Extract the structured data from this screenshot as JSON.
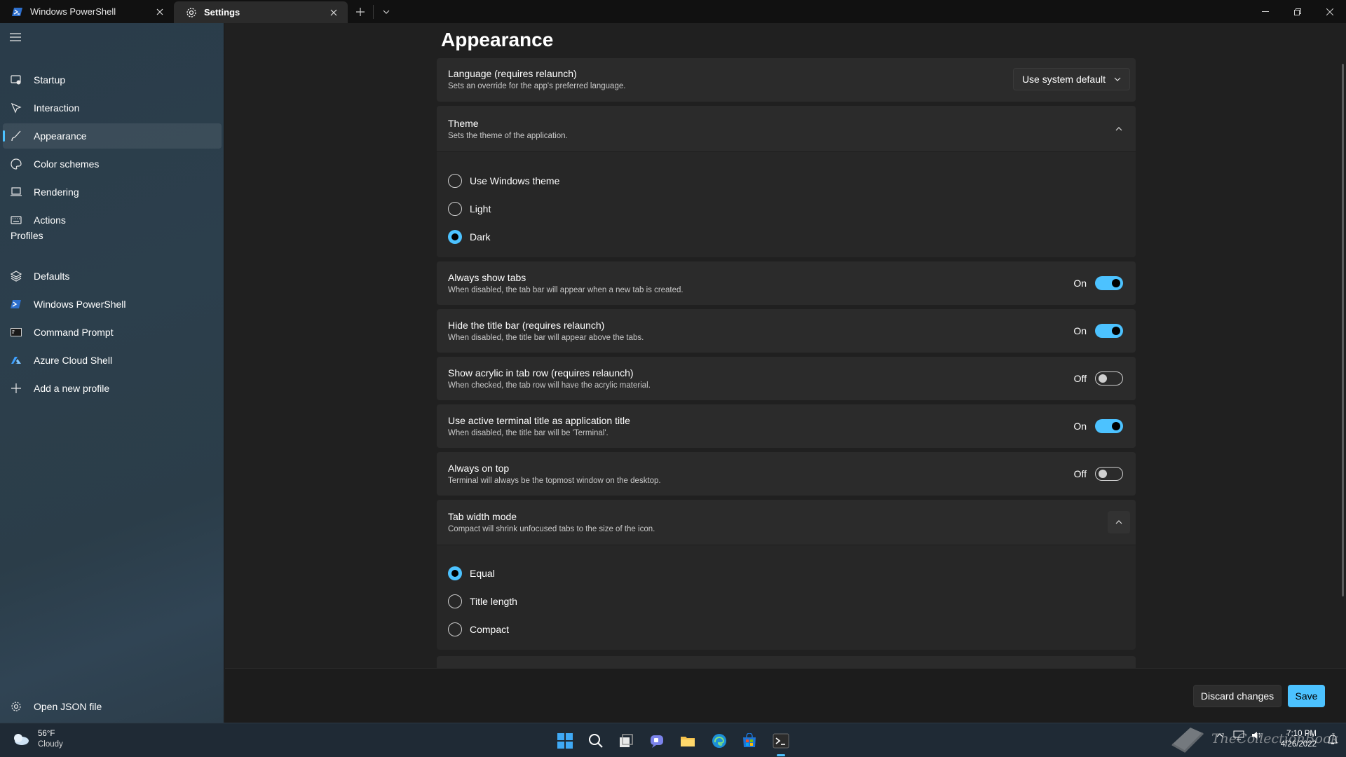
{
  "tabs": [
    {
      "title": "Windows PowerShell",
      "active": false
    },
    {
      "title": "Settings",
      "active": true
    }
  ],
  "sidebar": {
    "items": [
      {
        "label": "Startup",
        "icon": "startup-icon"
      },
      {
        "label": "Interaction",
        "icon": "interaction-icon"
      },
      {
        "label": "Appearance",
        "icon": "brush-icon",
        "selected": true
      },
      {
        "label": "Color schemes",
        "icon": "palette-icon"
      },
      {
        "label": "Rendering",
        "icon": "monitor-icon"
      },
      {
        "label": "Actions",
        "icon": "keyboard-icon"
      }
    ],
    "profiles_header": "Profiles",
    "profiles": [
      {
        "label": "Defaults",
        "icon": "layers-icon"
      },
      {
        "label": "Windows PowerShell",
        "icon": "powershell-icon"
      },
      {
        "label": "Command Prompt",
        "icon": "cmd-icon"
      },
      {
        "label": "Azure Cloud Shell",
        "icon": "azure-icon"
      },
      {
        "label": "Add a new profile",
        "icon": "plus-icon"
      }
    ],
    "open_json": "Open JSON file"
  },
  "page": {
    "title": "Appearance",
    "language": {
      "title": "Language (requires relaunch)",
      "desc": "Sets an override for the app's preferred language.",
      "value": "Use system default"
    },
    "theme": {
      "title": "Theme",
      "desc": "Sets the theme of the application.",
      "options": [
        "Use Windows theme",
        "Light",
        "Dark"
      ],
      "selected": "Dark"
    },
    "toggles": [
      {
        "title": "Always show tabs",
        "desc": "When disabled, the tab bar will appear when a new tab is created.",
        "state": "On"
      },
      {
        "title": "Hide the title bar (requires relaunch)",
        "desc": "When disabled, the title bar will appear above the tabs.",
        "state": "On"
      },
      {
        "title": "Show acrylic in tab row (requires relaunch)",
        "desc": "When checked, the tab row will have the acrylic material.",
        "state": "Off"
      },
      {
        "title": "Use active terminal title as application title",
        "desc": "When disabled, the title bar will be 'Terminal'.",
        "state": "On"
      },
      {
        "title": "Always on top",
        "desc": "Terminal will always be the topmost window on the desktop.",
        "state": "Off"
      }
    ],
    "tab_width": {
      "title": "Tab width mode",
      "desc": "Compact will shrink unfocused tabs to the size of the icon.",
      "options": [
        "Equal",
        "Title length",
        "Compact"
      ],
      "selected": "Equal"
    }
  },
  "footer": {
    "discard": "Discard changes",
    "save": "Save"
  },
  "taskbar": {
    "weather_temp": "56°F",
    "weather_desc": "Cloudy",
    "time": "7:10 PM",
    "date": "4/26/2022",
    "watermark": "TheCollectionBook"
  },
  "colors": {
    "accent": "#4cc2ff",
    "background": "#202020",
    "card": "#2b2b2b"
  }
}
